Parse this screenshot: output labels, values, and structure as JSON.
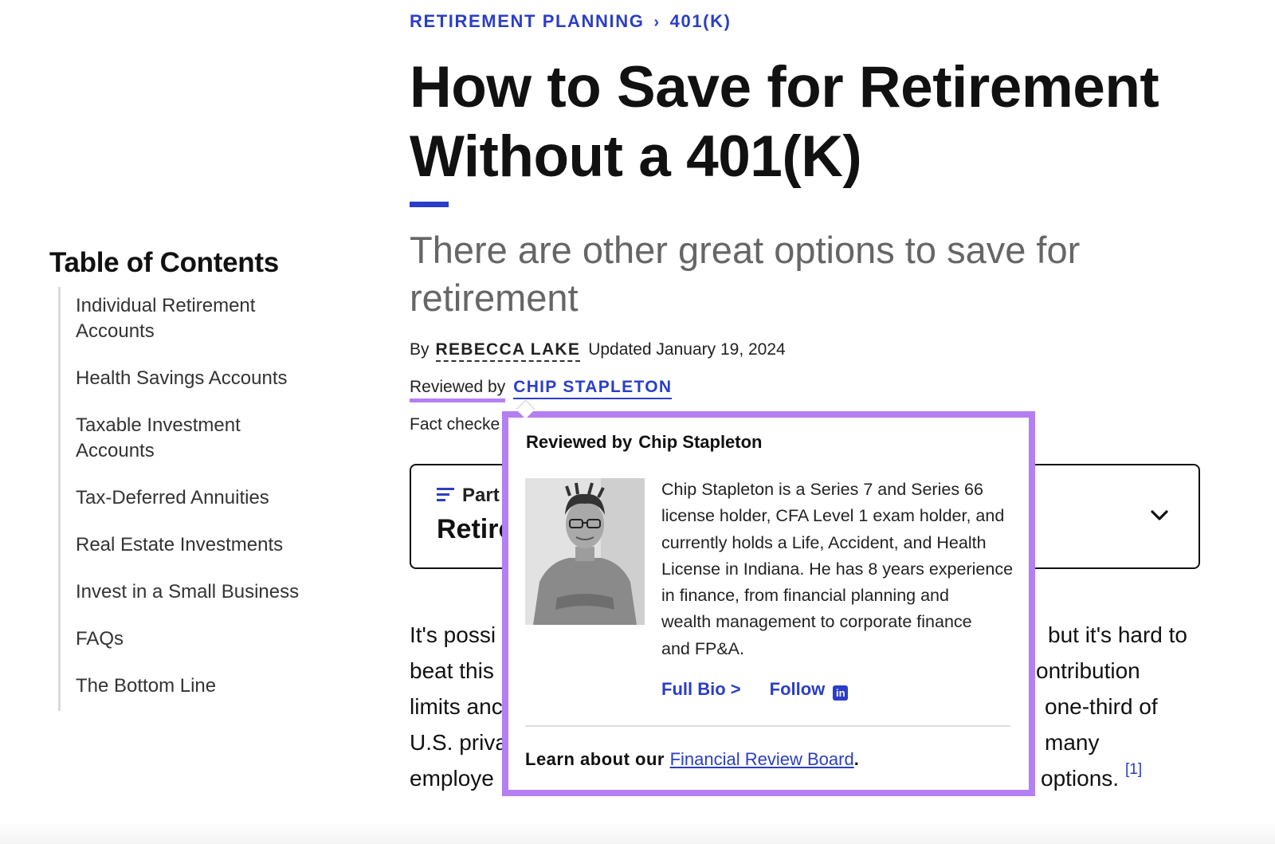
{
  "breadcrumb": {
    "parent": "RETIREMENT PLANNING",
    "separator": "›",
    "current": "401(K)"
  },
  "article": {
    "title_line1": "How to Save for Retirement",
    "title_line2": "Without a 401(K)",
    "subtitle_line1": "There are other great options to save for",
    "subtitle_line2": "retirement",
    "by_label": "By",
    "author": "REBECCA LAKE",
    "updated": "Updated January 19, 2024",
    "reviewed_label": "Reviewed by",
    "reviewer": "CHIP STAPLETON",
    "factcheck_partial": "Fact checke"
  },
  "toc": {
    "title": "Table of Contents",
    "items": [
      {
        "line1": "Individual Retirement",
        "line2": "Accounts"
      },
      {
        "line1": "Health Savings Accounts"
      },
      {
        "line1": "Taxable Investment",
        "line2": "Accounts"
      },
      {
        "line1": "Tax-Deferred Annuities"
      },
      {
        "line1": "Real Estate Investments"
      },
      {
        "line1": "Invest in a Small Business"
      },
      {
        "line1": "FAQs"
      },
      {
        "line1": "The Bottom Line"
      }
    ]
  },
  "part_card": {
    "label": "Part",
    "name": "Retire",
    "icon": "list-icon",
    "toggle_icon": "chevron-down-icon"
  },
  "body": {
    "left": [
      "It's possi",
      "beat this",
      "limits anc",
      "U.S. priva",
      "employe"
    ],
    "right": [
      "but it's hard to",
      "ontribution",
      "one-third of",
      "many",
      "options."
    ],
    "footnote": "[1]"
  },
  "popup": {
    "heading_label": "Reviewed by",
    "heading_name": "Chip Stapleton",
    "bio": [
      "Chip Stapleton is a Series 7 and Series 66",
      "license holder, CFA Level 1 exam holder, and",
      "currently holds a Life, Accident, and Health",
      "License in Indiana. He has 8 years experience",
      "in finance, from financial planning and",
      "wealth management to corporate finance",
      "and FP&A."
    ],
    "full_bio": "Full Bio >",
    "follow": "Follow",
    "follow_icon": "linkedin-icon",
    "learn_prefix": "Learn about our",
    "learn_link": "Financial Review Board",
    "learn_suffix": ".",
    "highlight_color": "#b47ff2"
  },
  "colors": {
    "accent": "#2b3ec7",
    "highlight": "#b47ff2"
  }
}
